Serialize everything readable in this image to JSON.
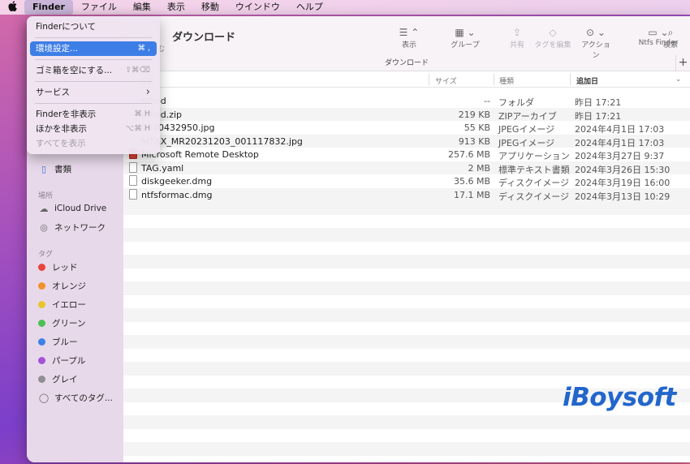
{
  "menubar": {
    "apple_icon": "apple-logo",
    "items": [
      "Finder",
      "ファイル",
      "編集",
      "表示",
      "移動",
      "ウインドウ",
      "ヘルプ"
    ]
  },
  "dropdown": {
    "items": [
      {
        "label": "Finderについて",
        "shortcut": ""
      },
      {
        "label": "環境設定...",
        "shortcut": "⌘ ,"
      },
      {
        "label": "ゴミ箱を空にする...",
        "shortcut": "⇧⌘⌫"
      },
      {
        "label": "サービス",
        "shortcut": "›"
      },
      {
        "label": "Finderを非表示",
        "shortcut": "⌘ H"
      },
      {
        "label": "ほかを非表示",
        "shortcut": "⌥⌘ H"
      },
      {
        "label": "すべてを表示",
        "shortcut": ""
      }
    ]
  },
  "window": {
    "title": "ダウンロード",
    "back_fragment": "む",
    "location_label": "ダウンロード"
  },
  "toolbar": {
    "view_label": "表示",
    "group_label": "グループ",
    "share_label": "共有",
    "tag_label": "タグを編集",
    "action_label": "アクション",
    "ntfs_label": "Ntfs Finder",
    "search_label": "検索",
    "plus": "+"
  },
  "sidebar": {
    "documents": "書類",
    "places_header": "場所",
    "icloud": "iCloud Drive",
    "network": "ネットワーク",
    "tags_header": "タグ",
    "tags": [
      {
        "label": "レッド",
        "color": "#e8453c"
      },
      {
        "label": "オレンジ",
        "color": "#f0922b"
      },
      {
        "label": "イエロー",
        "color": "#e8c52f"
      },
      {
        "label": "グリーン",
        "color": "#4cc055"
      },
      {
        "label": "ブルー",
        "color": "#3b82e6"
      },
      {
        "label": "パープル",
        "color": "#a352d8"
      },
      {
        "label": "グレイ",
        "color": "#8e8e93"
      }
    ],
    "all_tags": "すべてのタグ..."
  },
  "columns": {
    "name": "名前",
    "size": "サイズ",
    "kind": "種類",
    "date": "追加日"
  },
  "files": [
    {
      "name": "nified",
      "size": "--",
      "kind": "フォルダ",
      "date": "昨日 17:21"
    },
    {
      "name": "nified.zip",
      "size": "219 KB",
      "kind": "ZIPアーカイブ",
      "date": "昨日 17:21"
    },
    {
      "name": "0640432950.jpg",
      "size": "55 KB",
      "kind": "JPEGイメージ",
      "date": "2024年4月1日 17:03"
    },
    {
      "name": "MTXX_MR20231203_001117832.jpg",
      "size": "913 KB",
      "kind": "JPEGイメージ",
      "date": "2024年4月1日 17:03"
    },
    {
      "name": "Microsoft Remote Desktop",
      "size": "257.6 MB",
      "kind": "アプリケーション",
      "date": "2024年3月27日 9:37"
    },
    {
      "name": "TAG.yaml",
      "size": "2 MB",
      "kind": "標準テキスト書類",
      "date": "2024年3月26日 15:30"
    },
    {
      "name": "diskgeeker.dmg",
      "size": "35.6 MB",
      "kind": "ディスクイメージ",
      "date": "2024年3月19日 16:00"
    },
    {
      "name": "ntfsformac.dmg",
      "size": "17.1 MB",
      "kind": "ディスクイメージ",
      "date": "2024年3月13日 10:29"
    }
  ],
  "watermark": "iBoysoft"
}
